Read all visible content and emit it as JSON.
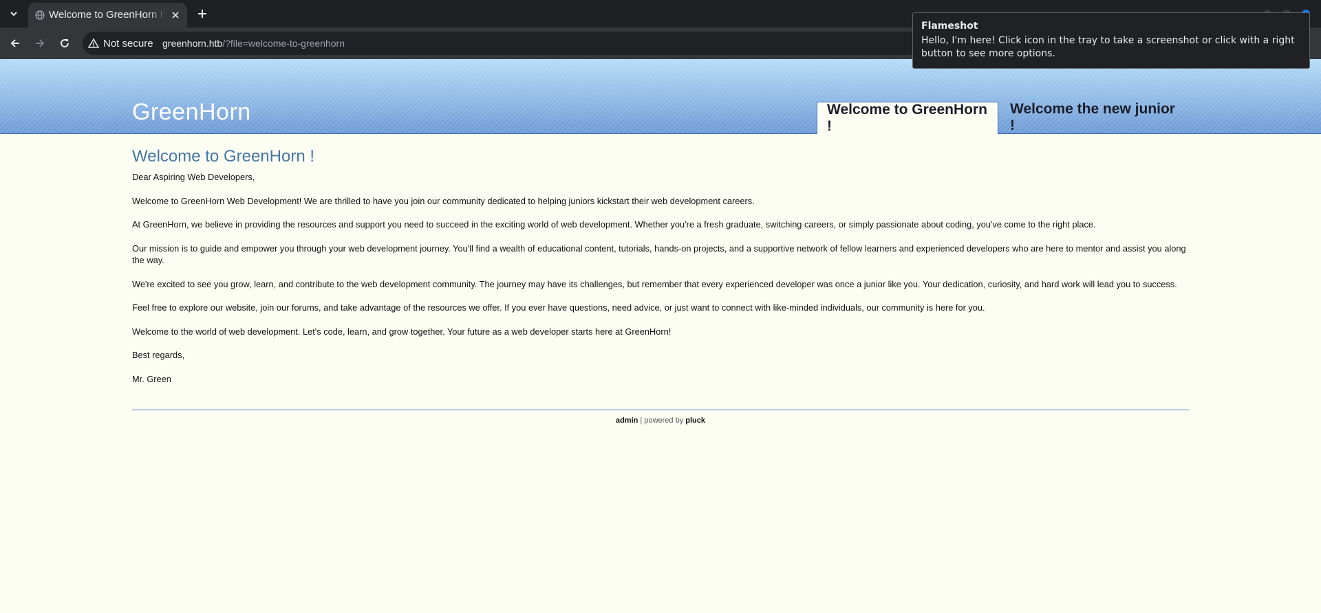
{
  "browser": {
    "tab_title": "Welcome to GreenHorn !",
    "security_label": "Not secure",
    "url_host": "greenhorn.htb",
    "url_path": "/?file=welcome-to-greenhorn",
    "icons": [
      "tab-list-icon",
      "globe-icon",
      "close-icon",
      "plus-icon",
      "back-icon",
      "forward-icon",
      "reload-icon",
      "warning-icon"
    ]
  },
  "site": {
    "title": "GreenHorn",
    "nav": [
      "Welcome to GreenHorn !",
      "Welcome the new junior !"
    ],
    "heading": "Welcome to GreenHorn !",
    "paragraphs": [
      "Dear Aspiring Web Developers,",
      "Welcome to GreenHorn Web Development! We are thrilled to have you join our community dedicated to helping juniors kickstart their web development careers.",
      "At GreenHorn, we believe in providing the resources and support you need to succeed in the exciting world of web development. Whether you're a fresh graduate, switching careers, or simply passionate about coding, you've come to the right place.",
      "Our mission is to guide and empower you through your web development journey. You'll find a wealth of educational content, tutorials, hands-on projects, and a supportive network of fellow learners and experienced developers who are here to mentor and assist you along the way.",
      "We're excited to see you grow, learn, and contribute to the web development community. The journey may have its challenges, but remember that every experienced developer was once a junior like you. Your dedication, curiosity, and hard work will lead you to success.",
      "Feel free to explore our website, join our forums, and take advantage of the resources we offer. If you ever have questions, need advice, or just want to connect with like-minded individuals, our community is here for you.",
      "Welcome to the world of web development. Let's code, learn, and grow together. Your future as a web developer starts here at GreenHorn!",
      "Best regards,",
      "Mr. Green"
    ],
    "footer": {
      "admin_link": "admin",
      "separator": " | powered by ",
      "pluck_link": "pluck"
    }
  },
  "notification": {
    "title": "Flameshot",
    "body": "Hello, I'm here! Click icon in the tray to take a screenshot or click with a right button to see more options."
  },
  "colors": {
    "heading": "#4476a6",
    "header_blue": "#8fb9e6",
    "page_bg": "#fdfef3",
    "rule": "#4a7fbf"
  }
}
